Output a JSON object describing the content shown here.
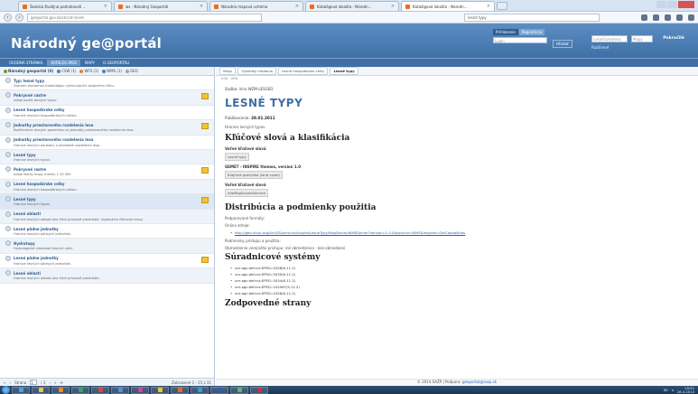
{
  "browser": {
    "tabs": [
      {
        "label": "Školská študijná podrobnosti ..."
      },
      {
        "label": "ws - Národný Geoportál"
      },
      {
        "label": "Národná mapová schéma"
      },
      {
        "label": "Katalógová lokalita - Národn..."
      },
      {
        "label": "Katalógová lokalita - Národn..."
      }
    ],
    "url": "geoportal.gov.sk/sk/cat-client",
    "search": "lesné typy"
  },
  "header": {
    "logo": "Národný ge@portál",
    "login_tab_1": "Prihlásenie",
    "login_tab_2": "Registrácia",
    "login_placeholder": "Login",
    "login_button": "Hľadať",
    "search_field_1": "Lokalita/adresa",
    "search_field_2": "Mapy",
    "search_button": "Pokročilé",
    "search_link": "Rozšírené"
  },
  "mainnav": {
    "items": [
      "ÚVODNÁ STRÁNKA",
      "KATALÓG MDS",
      "MAPY",
      "O GEOPORTÁLI"
    ]
  },
  "left": {
    "toolbar": [
      {
        "label": "Národný geoportál (0)",
        "color": "green"
      },
      {
        "label": "CSW (1)",
        "color": "blue"
      },
      {
        "label": "WFS (1)",
        "color": "orange"
      },
      {
        "label": "WMS (1)",
        "color": "blue"
      },
      {
        "label": "GEO",
        "color": "gray"
      }
    ],
    "records": [
      {
        "title": "Typ: lesné typy",
        "desc": "Zoznam záznamov metaúdajov vyhovujúcich zadanému filtru.",
        "badge": false
      },
      {
        "title": "Pokryvné rastre",
        "desc": "údaje podľa lesných typov",
        "badge": true
      },
      {
        "title": "Lesné hospodárske celky",
        "desc": "Hranice lesných hospodárskych celkov.",
        "badge": false
      },
      {
        "title": "Jednotky priestorového rozdelenia lesa",
        "desc": "Rozčlenenie lesných pozemkov na jednotky priestorového rozdelenia lesa.",
        "badge": true
      },
      {
        "title": "Jednotky priestorového rozdelenia lesa",
        "desc": "Hranice lesných porastov a jednotiek rozdelenia lesa.",
        "badge": false
      },
      {
        "title": "Lesné typy",
        "desc": "Hranice lesných typov.",
        "badge": false
      },
      {
        "title": "Pokryvné rastre",
        "desc": "údaje lesnej mapy mierky 1:10 000",
        "badge": true
      },
      {
        "title": "Lesné hospodárske celky",
        "desc": "Hranice lesných hospodárskych celkov.",
        "badge": false
      },
      {
        "title": "Lesné typy",
        "desc": "Hranice lesných typov.",
        "badge": true
      },
      {
        "title": "Lesné oblasti",
        "desc": "Hranice lesných oblastí ako člení prírodné prostredie, regionálne členenie lesov.",
        "badge": false
      },
      {
        "title": "Lesné pôdne jednotky",
        "desc": "Hranice lesných pôdnych jednotiek.",
        "badge": false
      },
      {
        "title": "Hydrotopy",
        "desc": "Hydrologické vlastnosti lesných pôd.",
        "badge": false
      },
      {
        "title": "Lesné pôdne jednotky",
        "desc": "Hranice lesných pôdnych jednotiek.",
        "badge": true
      },
      {
        "title": "Lesné oblasti",
        "desc": "Hranice lesných oblastí ako člení prírodné prostredie.",
        "badge": false
      }
    ],
    "pager": {
      "page_label": "Strana",
      "page_value": "1",
      "of": "/ 3",
      "summary": "Zobrazené 1 - 15 z 31"
    }
  },
  "right": {
    "breadcrumbs": [
      "Mapy",
      "Výsledky hľadania",
      "Lesné hospodárske celky",
      "Lesné typy"
    ],
    "tools": "Info  ·  XML",
    "meta": "Služba: id-iv WZM-LESGEO",
    "title": "LESNÉ TYPY",
    "published_label": "Publikovanie:",
    "published_value": "28.01.2011",
    "description": "Hranice lesných typov",
    "keywords_heading": "Kľúčové slová a klasifikácia",
    "free_keywords_label": "Voľné kľúčové slová",
    "free_keywords": [
      "Lesné typy"
    ],
    "gemet_label": "GEMET - INSPIRE themes, version 1.0",
    "gemet_keywords": [
      "Krajinná pokrývka (land cover)"
    ],
    "free_keywords_2_label": "Voľné kľúčové slová",
    "free_keywords_2": [
      "infoMapAccessService"
    ],
    "distribution_heading": "Distribúcia a podmienky použitia",
    "format_label": "Podporované formáty:",
    "online_label": "Online zdroje:",
    "online_link": "http://geo.nlcsk.org/ArcGIS/services/inspire/LesneTypy/MapServer/WMSServer?version=1.3.0&service=WMS&request=GetCapabilities",
    "access_1": "Podmienky prístupu a použitia:",
    "access_2": "Obmedzenie verejného prístupu: iné obmedzenia - bez obmedzení",
    "crs_heading": "Súradnicové systémy",
    "crs": [
      "urn:ogc:def:crs:EPSG::4258(6.11.2)",
      "urn:ogc:def:crs:EPSG::3035(6.11.2)",
      "urn:ogc:def:crs:EPSG::3034(6.11.2)",
      "urn:ogc:def:crs:EPSG::102067(5.11.2)",
      "urn:ogc:def:crs:EPSG::4326(6.11.2)"
    ],
    "responsible_heading": "Zodpovedné strany",
    "copyright_text": "© 2014 SAŽP | Podpora:",
    "copyright_link": "geoportal@sazp.sk"
  },
  "taskbar": {
    "tray_text": "SK",
    "time": "19:51",
    "date": "28.4.2014"
  },
  "colors": {
    "header_blue": "#3e6fa6",
    "title_blue": "#3f6fa5",
    "link_blue": "#2a62b3",
    "badge_yellow": "#f1c232"
  }
}
